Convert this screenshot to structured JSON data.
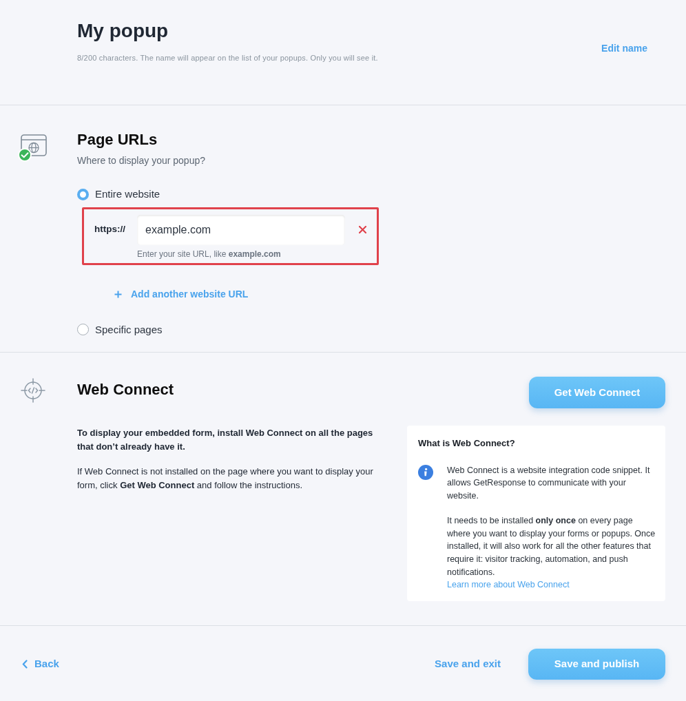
{
  "header": {
    "title": "My popup",
    "hint": "8/200 characters. The name will appear on the list of your popups. Only you will see it.",
    "edit_link": "Edit name"
  },
  "page_urls": {
    "title": "Page URLs",
    "completed": true,
    "subtitle": "Where to display your popup?",
    "options": [
      {
        "label": "Entire website",
        "selected": true
      },
      {
        "label": "Specific pages",
        "selected": false
      }
    ],
    "url_entries": [
      {
        "prefix": "https://",
        "value": "example.com",
        "hint": "Enter your site URL, like **example.com**",
        "highlighted": true
      }
    ],
    "add_link": "Add another website URL"
  },
  "web_connect": {
    "title": "Web Connect",
    "completed": false,
    "button": "Get Web Connect",
    "intro": "To display your embedded form, install Web Connect on all the pages that don’t already have it.",
    "instructions": "If Web Connect is not installed on the page where you want to display your form, click **Get Web Connect** and follow the instructions.",
    "info": {
      "title": "What is Web Connect?",
      "paragraphs": [
        "Web Connect is a website integration code snippet. It allows GetResponse to communicate with your website.",
        "It needs to be installed **only once** on every page where you want to display your forms or popups. Once installed, it will also work for all the other features that require it: visitor tracking, automation, and push notifications."
      ],
      "link": "Learn more about Web Connect"
    }
  },
  "footer": {
    "back": "Back",
    "save_exit": "Save and exit",
    "publish": "Save and publish"
  }
}
